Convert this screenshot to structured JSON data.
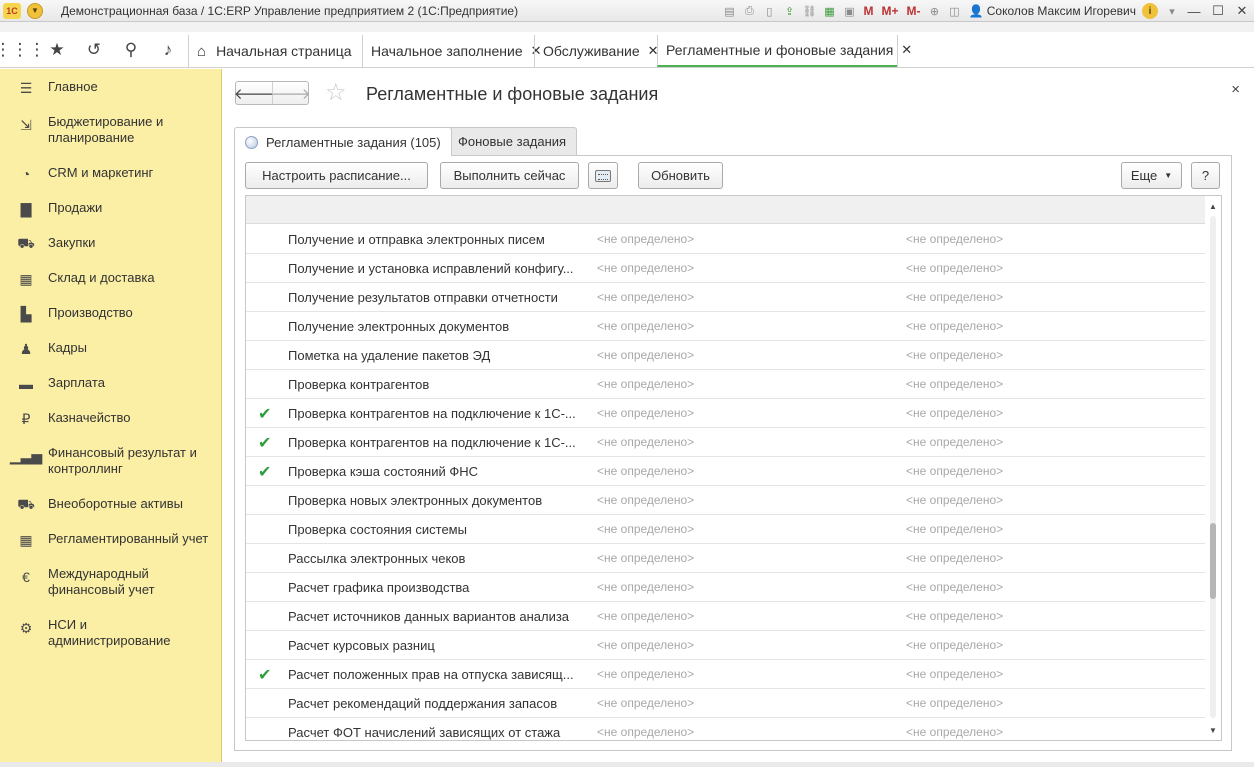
{
  "window": {
    "title": "Демонстрационная база / 1С:ERP Управление предприятием 2  (1С:Предприятие)",
    "app_logo": "1С",
    "user": "Соколов Максим Игоревич",
    "memory_buttons": [
      "M",
      "M+",
      "M-"
    ],
    "controls": [
      "minimize",
      "maximize",
      "close"
    ]
  },
  "top_icons": [
    "apps-grid-icon",
    "star-icon",
    "history-icon",
    "search-icon",
    "bell-icon"
  ],
  "tabs": [
    {
      "label": "Начальная страница",
      "icon": "home-icon",
      "closable": false
    },
    {
      "label": "Начальное заполнение",
      "closable": true
    },
    {
      "label": "Обслуживание",
      "closable": true
    },
    {
      "label": "Регламентные и фоновые задания",
      "closable": true,
      "active": true
    }
  ],
  "sidebar": {
    "items": [
      {
        "label": "Главное",
        "icon": "menu-lines-icon"
      },
      {
        "label": "Бюджетирование и планирование",
        "icon": "budget-icon"
      },
      {
        "label": "CRM и маркетинг",
        "icon": "pie-chart-icon"
      },
      {
        "label": "Продажи",
        "icon": "bag-icon"
      },
      {
        "label": "Закупки",
        "icon": "cart-icon"
      },
      {
        "label": "Склад и доставка",
        "icon": "warehouse-icon"
      },
      {
        "label": "Производство",
        "icon": "factory-icon"
      },
      {
        "label": "Кадры",
        "icon": "person-icon"
      },
      {
        "label": "Зарплата",
        "icon": "card-icon"
      },
      {
        "label": "Казначейство",
        "icon": "ruble-coin-icon"
      },
      {
        "label": "Финансовый результат и контроллинг",
        "icon": "bar-chart-icon"
      },
      {
        "label": "Внеоборотные активы",
        "icon": "truck-icon"
      },
      {
        "label": "Регламентированный учет",
        "icon": "calculator-icon"
      },
      {
        "label": "Международный финансовый учет",
        "icon": "euro-coin-icon"
      },
      {
        "label": "НСИ и администрирование",
        "icon": "gear-icon"
      }
    ]
  },
  "form": {
    "title": "Регламентные и фоновые задания",
    "close": "×",
    "tabs": [
      {
        "label": "Регламентные задания (105)",
        "active": true
      },
      {
        "label": "Фоновые задания",
        "active": false
      }
    ],
    "toolbar": {
      "schedule": "Настроить расписание...",
      "run_now": "Выполнить сейчас",
      "refresh": "Обновить",
      "more": "Еще",
      "help": "?"
    },
    "scroll_position": 0.72,
    "rows": [
      {
        "checked": false,
        "name": "Получение и отправка электронных писем",
        "c2": "<не определено>",
        "c3": "<не определено>"
      },
      {
        "checked": false,
        "name": "Получение и установка исправлений конфигу...",
        "c2": "<не определено>",
        "c3": "<не определено>"
      },
      {
        "checked": false,
        "name": "Получение результатов отправки отчетности",
        "c2": "<не определено>",
        "c3": "<не определено>"
      },
      {
        "checked": false,
        "name": "Получение электронных документов",
        "c2": "<не определено>",
        "c3": "<не определено>"
      },
      {
        "checked": false,
        "name": "Пометка на удаление пакетов ЭД",
        "c2": "<не определено>",
        "c3": "<не определено>"
      },
      {
        "checked": false,
        "name": "Проверка контрагентов",
        "c2": "<не определено>",
        "c3": "<не определено>"
      },
      {
        "checked": true,
        "name": "Проверка контрагентов на подключение к 1С-...",
        "c2": "<не определено>",
        "c3": "<не определено>"
      },
      {
        "checked": true,
        "name": "Проверка контрагентов на подключение к 1С-...",
        "c2": "<не определено>",
        "c3": "<не определено>"
      },
      {
        "checked": true,
        "name": "Проверка кэша состояний ФНС",
        "c2": "<не определено>",
        "c3": "<не определено>"
      },
      {
        "checked": false,
        "name": "Проверка новых электронных документов",
        "c2": "<не определено>",
        "c3": "<не определено>"
      },
      {
        "checked": false,
        "name": "Проверка состояния системы",
        "c2": "<не определено>",
        "c3": "<не определено>"
      },
      {
        "checked": false,
        "name": "Рассылка электронных чеков",
        "c2": "<не определено>",
        "c3": "<не определено>"
      },
      {
        "checked": false,
        "name": "Расчет графика производства",
        "c2": "<не определено>",
        "c3": "<не определено>"
      },
      {
        "checked": false,
        "name": "Расчет источников данных вариантов анализа",
        "c2": "<не определено>",
        "c3": "<не определено>"
      },
      {
        "checked": false,
        "name": "Расчет курсовых разниц",
        "c2": "<не определено>",
        "c3": "<не определено>"
      },
      {
        "checked": true,
        "name": "Расчет положенных прав на отпуска зависящ...",
        "c2": "<не определено>",
        "c3": "<не определено>"
      },
      {
        "checked": false,
        "name": "Расчет рекомендаций поддержания запасов",
        "c2": "<не определено>",
        "c3": "<не определено>"
      },
      {
        "checked": false,
        "name": "Расчет ФОТ начислений зависящих от стажа",
        "c2": "<не определено>",
        "c3": "<не определено>"
      }
    ]
  },
  "colors": {
    "sidebar_bg": "#fbeea5",
    "active_tab_underline": "#4caf50",
    "check": "#2e9e3e",
    "placeholder_text": "#a8a8a8"
  }
}
